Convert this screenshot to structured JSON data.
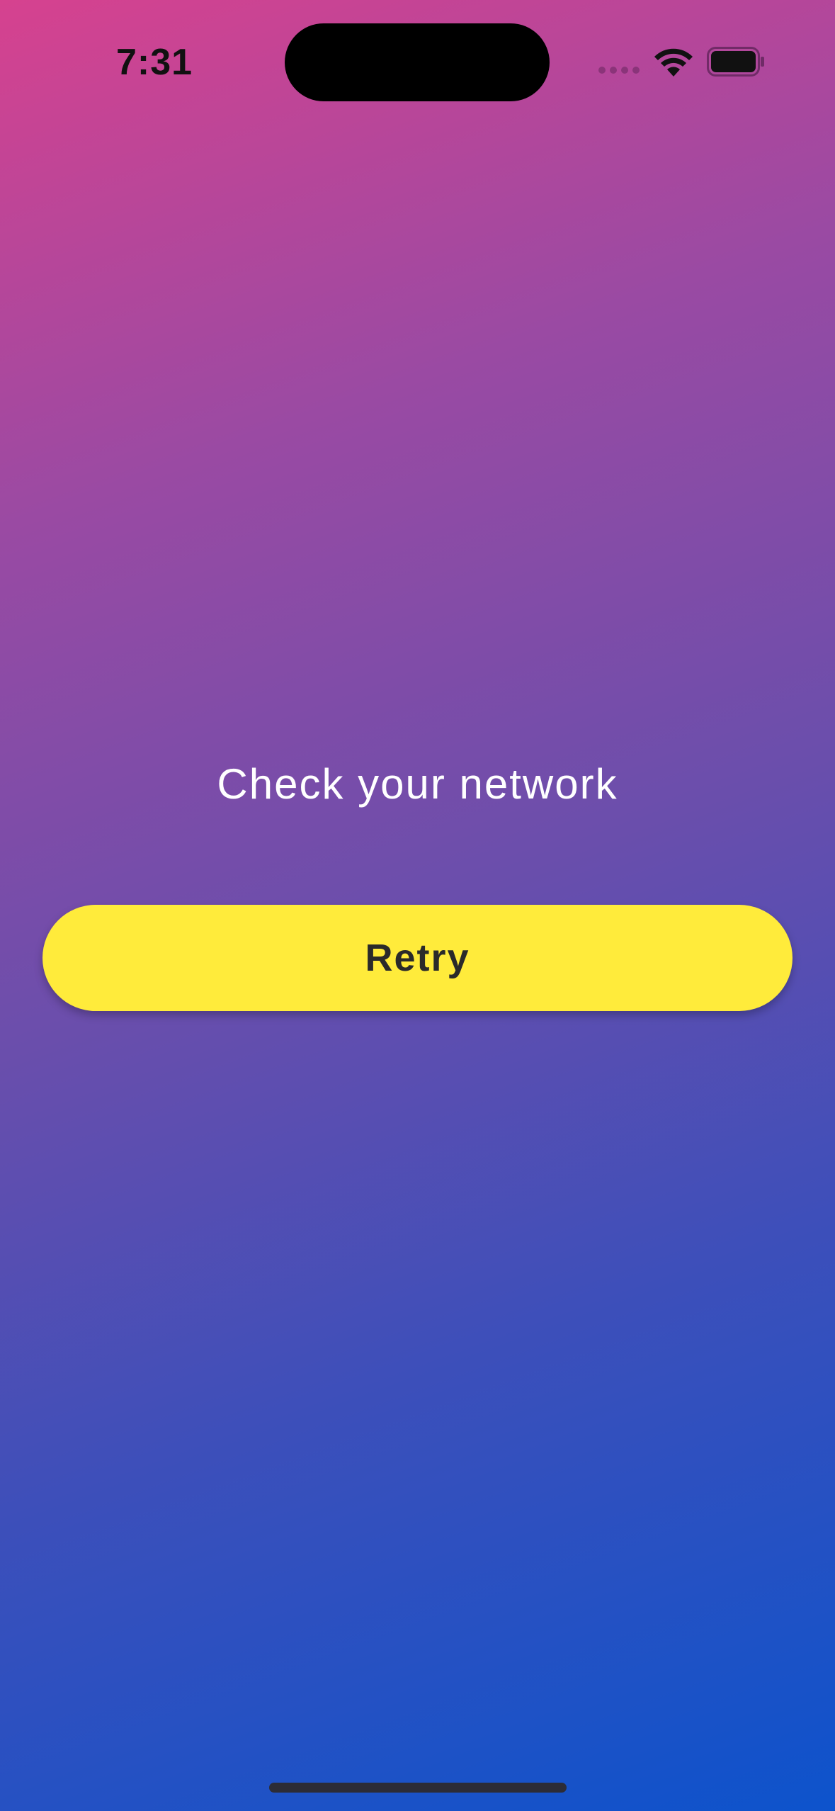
{
  "status_bar": {
    "time": "7:31",
    "icons": [
      "cellular-signal-icon",
      "wifi-icon",
      "battery-icon"
    ]
  },
  "main": {
    "message": "Check your network",
    "retry_label": "Retry"
  },
  "colors": {
    "gradient_start": "#d6428f",
    "gradient_end": "#0d53cc",
    "button": "#ffeb3b",
    "button_text": "#2a2a2a",
    "message_text": "#ffffff"
  }
}
